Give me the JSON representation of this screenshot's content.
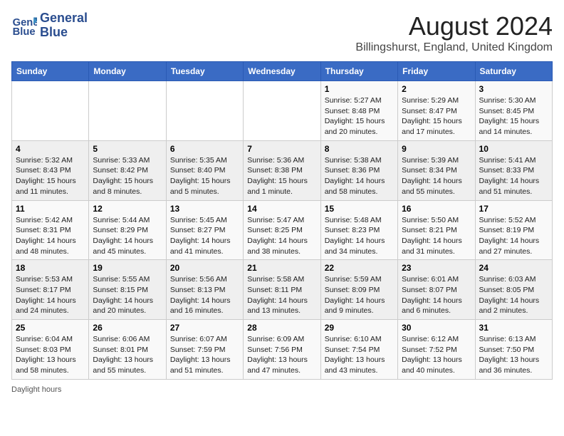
{
  "header": {
    "logo_line1": "General",
    "logo_line2": "Blue",
    "main_title": "August 2024",
    "sub_title": "Billingshurst, England, United Kingdom"
  },
  "columns": [
    "Sunday",
    "Monday",
    "Tuesday",
    "Wednesday",
    "Thursday",
    "Friday",
    "Saturday"
  ],
  "weeks": [
    [
      {
        "day": "",
        "info": ""
      },
      {
        "day": "",
        "info": ""
      },
      {
        "day": "",
        "info": ""
      },
      {
        "day": "",
        "info": ""
      },
      {
        "day": "1",
        "info": "Sunrise: 5:27 AM\nSunset: 8:48 PM\nDaylight: 15 hours and 20 minutes."
      },
      {
        "day": "2",
        "info": "Sunrise: 5:29 AM\nSunset: 8:47 PM\nDaylight: 15 hours and 17 minutes."
      },
      {
        "day": "3",
        "info": "Sunrise: 5:30 AM\nSunset: 8:45 PM\nDaylight: 15 hours and 14 minutes."
      }
    ],
    [
      {
        "day": "4",
        "info": "Sunrise: 5:32 AM\nSunset: 8:43 PM\nDaylight: 15 hours and 11 minutes."
      },
      {
        "day": "5",
        "info": "Sunrise: 5:33 AM\nSunset: 8:42 PM\nDaylight: 15 hours and 8 minutes."
      },
      {
        "day": "6",
        "info": "Sunrise: 5:35 AM\nSunset: 8:40 PM\nDaylight: 15 hours and 5 minutes."
      },
      {
        "day": "7",
        "info": "Sunrise: 5:36 AM\nSunset: 8:38 PM\nDaylight: 15 hours and 1 minute."
      },
      {
        "day": "8",
        "info": "Sunrise: 5:38 AM\nSunset: 8:36 PM\nDaylight: 14 hours and 58 minutes."
      },
      {
        "day": "9",
        "info": "Sunrise: 5:39 AM\nSunset: 8:34 PM\nDaylight: 14 hours and 55 minutes."
      },
      {
        "day": "10",
        "info": "Sunrise: 5:41 AM\nSunset: 8:33 PM\nDaylight: 14 hours and 51 minutes."
      }
    ],
    [
      {
        "day": "11",
        "info": "Sunrise: 5:42 AM\nSunset: 8:31 PM\nDaylight: 14 hours and 48 minutes."
      },
      {
        "day": "12",
        "info": "Sunrise: 5:44 AM\nSunset: 8:29 PM\nDaylight: 14 hours and 45 minutes."
      },
      {
        "day": "13",
        "info": "Sunrise: 5:45 AM\nSunset: 8:27 PM\nDaylight: 14 hours and 41 minutes."
      },
      {
        "day": "14",
        "info": "Sunrise: 5:47 AM\nSunset: 8:25 PM\nDaylight: 14 hours and 38 minutes."
      },
      {
        "day": "15",
        "info": "Sunrise: 5:48 AM\nSunset: 8:23 PM\nDaylight: 14 hours and 34 minutes."
      },
      {
        "day": "16",
        "info": "Sunrise: 5:50 AM\nSunset: 8:21 PM\nDaylight: 14 hours and 31 minutes."
      },
      {
        "day": "17",
        "info": "Sunrise: 5:52 AM\nSunset: 8:19 PM\nDaylight: 14 hours and 27 minutes."
      }
    ],
    [
      {
        "day": "18",
        "info": "Sunrise: 5:53 AM\nSunset: 8:17 PM\nDaylight: 14 hours and 24 minutes."
      },
      {
        "day": "19",
        "info": "Sunrise: 5:55 AM\nSunset: 8:15 PM\nDaylight: 14 hours and 20 minutes."
      },
      {
        "day": "20",
        "info": "Sunrise: 5:56 AM\nSunset: 8:13 PM\nDaylight: 14 hours and 16 minutes."
      },
      {
        "day": "21",
        "info": "Sunrise: 5:58 AM\nSunset: 8:11 PM\nDaylight: 14 hours and 13 minutes."
      },
      {
        "day": "22",
        "info": "Sunrise: 5:59 AM\nSunset: 8:09 PM\nDaylight: 14 hours and 9 minutes."
      },
      {
        "day": "23",
        "info": "Sunrise: 6:01 AM\nSunset: 8:07 PM\nDaylight: 14 hours and 6 minutes."
      },
      {
        "day": "24",
        "info": "Sunrise: 6:03 AM\nSunset: 8:05 PM\nDaylight: 14 hours and 2 minutes."
      }
    ],
    [
      {
        "day": "25",
        "info": "Sunrise: 6:04 AM\nSunset: 8:03 PM\nDaylight: 13 hours and 58 minutes."
      },
      {
        "day": "26",
        "info": "Sunrise: 6:06 AM\nSunset: 8:01 PM\nDaylight: 13 hours and 55 minutes."
      },
      {
        "day": "27",
        "info": "Sunrise: 6:07 AM\nSunset: 7:59 PM\nDaylight: 13 hours and 51 minutes."
      },
      {
        "day": "28",
        "info": "Sunrise: 6:09 AM\nSunset: 7:56 PM\nDaylight: 13 hours and 47 minutes."
      },
      {
        "day": "29",
        "info": "Sunrise: 6:10 AM\nSunset: 7:54 PM\nDaylight: 13 hours and 43 minutes."
      },
      {
        "day": "30",
        "info": "Sunrise: 6:12 AM\nSunset: 7:52 PM\nDaylight: 13 hours and 40 minutes."
      },
      {
        "day": "31",
        "info": "Sunrise: 6:13 AM\nSunset: 7:50 PM\nDaylight: 13 hours and 36 minutes."
      }
    ]
  ],
  "footer": "Daylight hours"
}
